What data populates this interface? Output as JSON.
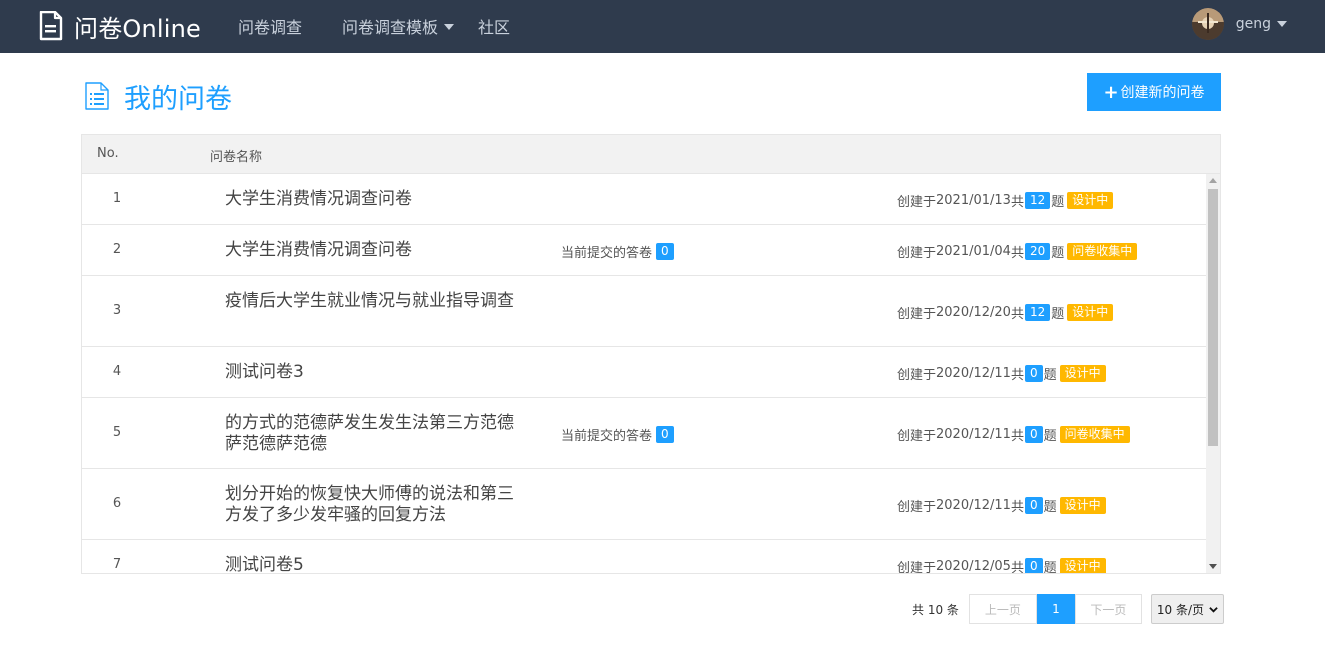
{
  "nav": {
    "brand": "问卷Online",
    "links": [
      "问卷调查",
      "问卷调查模板",
      "社区"
    ],
    "user": "geng",
    "icons": {
      "brand": "document-icon",
      "avatar": "avatar-image",
      "caret": "caret-down-icon"
    }
  },
  "header": {
    "title": "我的问卷",
    "create_label": "创建新的问卷",
    "create_plus": "+"
  },
  "table": {
    "columns": {
      "no": "No.",
      "name": "问卷名称"
    },
    "submit_label": "当前提交的答卷",
    "created_prefix": "创建于",
    "count_prefix": "共",
    "count_suffix": "题",
    "rows": [
      {
        "no": "1",
        "name": "大学生消费情况调查问卷",
        "submissions": null,
        "date": "2021/01/13",
        "questions": "12",
        "status": "设计中"
      },
      {
        "no": "2",
        "name": "大学生消费情况调查问卷",
        "submissions": "0",
        "date": "2021/01/04",
        "questions": "20",
        "status": "问卷收集中"
      },
      {
        "no": "3",
        "name": "疫情后大学生就业情况与就业指导调查",
        "submissions": null,
        "date": "2020/12/20",
        "questions": "12",
        "status": "设计中"
      },
      {
        "no": "4",
        "name": "测试问卷3",
        "submissions": null,
        "date": "2020/12/11",
        "questions": "0",
        "status": "设计中"
      },
      {
        "no": "5",
        "name": "的方式的范德萨发生发生法第三方范德萨范德萨范德",
        "submissions": "0",
        "date": "2020/12/11",
        "questions": "0",
        "status": "问卷收集中"
      },
      {
        "no": "6",
        "name": "划分开始的恢复快大师傅的说法和第三方发了多少发牢骚的回复方法",
        "submissions": null,
        "date": "2020/12/11",
        "questions": "0",
        "status": "设计中"
      },
      {
        "no": "7",
        "name": "测试问卷5",
        "submissions": null,
        "date": "2020/12/05",
        "questions": "0",
        "status": "设计中"
      }
    ]
  },
  "pagination": {
    "total": "共 10 条",
    "prev": "上一页",
    "current": "1",
    "next": "下一页",
    "page_size": "10 条/页"
  },
  "colors": {
    "navbar": "#2f3b4d",
    "accent": "#1e9fff",
    "warning": "#ffb800"
  }
}
